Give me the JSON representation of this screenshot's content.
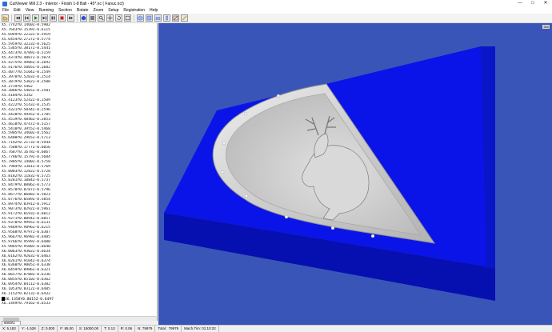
{
  "window": {
    "title": "CutViewer Mill 2.3 - Interior - Finish 1-8 Ball - 45*.nc ( Fanuc.ncl)",
    "controls": [
      "—",
      "□",
      "✕"
    ]
  },
  "menu": [
    "File",
    "Edit",
    "View",
    "Running",
    "Section",
    "Rotate",
    "Zoom",
    "Setup",
    "Registration",
    "Help"
  ],
  "toolbar_icons": [
    "open-icon",
    "rewind-icon",
    "step-back-icon",
    "play-icon",
    "step-icon",
    "pause-icon",
    "stop-icon",
    "end-icon",
    "solid-view-icon",
    "shade-icon",
    "zoom-icon",
    "pan-icon",
    "rotate-icon",
    "fit-icon",
    "iso-view-icon",
    "top-view-icon",
    "front-view-icon",
    "side-view-icon",
    "section-icon",
    "measure-icon"
  ],
  "code_lines": [
    "X5.7742Y0.1460Z-0.5902",
    "X5.7643Y0.1539Z-0.6115",
    "X5.6949Y0.2232Z-0.5919",
    "X5.6454Y0.2727Z-0.5774",
    "X5.5959Y0.3223Z-0.5625",
    "X5.5365Y0.3817Z-0.5441",
    "X5.4473Y0.4709Z-0.5159",
    "X5.4374Y0.4807Z-0.5074",
    "X5.4275Y0.4906Z-0.2692",
    "X5.4176Y0.5005Z-0.2602",
    "X5.4077Y0.5104Z-0.2549",
    "X5.3978Y0.5203Z-0.2514",
    "X5.3879Y0.5302Z-0.2500",
    "X4.3719Y0.5462",
    "X4.3866Y0.5465Z-0.2501",
    "X5.4104Y0.5342",
    "X5.4123Y0.5242Z-0.2509",
    "X5.4222Y0.5143Z-0.2535",
    "X5.4321Y0.5044Z-0.2596",
    "X5.4420Y0.4945Z-0.2705",
    "X5.4519Y0.4846Z-0.2853",
    "X5.4618Y0.4747Z-0.5157",
    "X5.5410Y0.3955Z-0.5468",
    "X5.5905Y0.3460Z-0.5562",
    "X5.6400Y0.2965Z-0.5713",
    "X5.7192Y0.2173Z-0.5944",
    "X5.7588Y0.1777Z-0.6056",
    "X5.7687Y0.1678Z-0.6067",
    "X5.7786Y0.1579Z-0.5684",
    "X5.7885Y0.1480Z-0.5758",
    "X5.7984Y0.1381Z-0.5769",
    "X5.8083Y0.1282Z-0.5728",
    "X5.8182Y0.1183Z-0.5725",
    "X5.8281Y0.1084Z-0.5737",
    "X5.8479Y0.0886Z-0.5773",
    "X5.8578Y0.0787Z-0.5796",
    "X5.8677Y0.0688Z-0.5823",
    "X5.8776Y0.0589Z-0.5854",
    "X5.8974Y0.0391Z-0.5912",
    "X5.9073Y0.0292Z-0.5961",
    "X5.9172Y0.0193Z-0.6012",
    "X5.9271Y0.0094Z-0.6057",
    "X5.9370Y0.9995Z-0.6131",
    "X5.9469Y0.9896Z-0.6215",
    "X5.9568Y0.9797Z-0.6307",
    "X5.9667Y0.9698Z-0.6405",
    "X5.9766Y0.9599Z-0.6480",
    "X5.9865Y0.9500Z-0.6640",
    "X6.0063Y0.9302Z-0.6634",
    "X6.0162Y0.9203Z-0.6463",
    "X6.0261Y0.9104Z-0.6374",
    "X6.0360Y0.9005Z-0.6330",
    "X6.0459Y0.8906Z-0.6321",
    "X6.0657Y0.8708Z-0.6336",
    "X6.0855Y0.8510Z-0.6362",
    "X6.0954Y0.8411Z-0.6382",
    "X6.1053Y0.8312Z-0.6405",
    "X6.1152Y0.8213Z-0.6432",
    "X6.1350Y0.8015Z-0.6497",
    "X6.1449Y0.7916Z-0.6533"
  ],
  "current_line_index": 58,
  "left_tab": "8000\\1",
  "zoom_badge": "350",
  "status": {
    "x": "X: 5.183",
    "y": "Y: -1.528",
    "z": "Z: 0.000",
    "f": "F: 85.00",
    "s": "S: 15000.00",
    "t": "T: 0.13",
    "r": "R: 0.06",
    "n": "N: 79979",
    "total": "Total : 79979",
    "time": "Mach.Tim: 01:10:22"
  },
  "colors": {
    "viewport_bg": "#3a55b8",
    "block_top": "#0a14e8",
    "block_side": "#0610b0",
    "relief": "#c7c7c7"
  }
}
